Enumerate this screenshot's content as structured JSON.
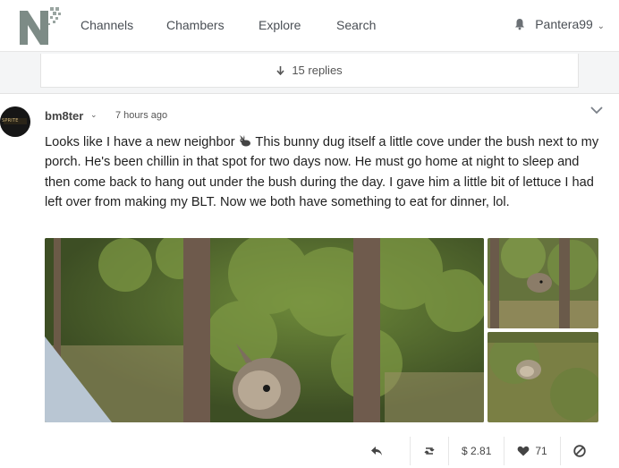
{
  "nav": {
    "links": [
      "Channels",
      "Chambers",
      "Explore",
      "Search"
    ],
    "username": "Pantera99",
    "bell_icon": "bell-icon",
    "brand_color": "#7d8b86"
  },
  "replies": {
    "label": "15 replies",
    "icon": "arrow-down-icon"
  },
  "post": {
    "author": "bm8ter",
    "avatar_text": "SPRITE",
    "timestamp": "7 hours ago",
    "text_before_emoji": "Looks like I have a new neighbor ",
    "text_after_emoji": " This bunny dug itself a little cove under the bush next to my porch. He's been chillin in that spot for two days now. He must go home at night to sleep and then come back to hang out under the bush during the day. I gave him a little bit of lettuce I had left over from making my BLT. Now we both have something to eat for dinner, lol.",
    "emoji_icon": "bunny-emoji-icon",
    "images": [
      "bunny-under-bush-photo",
      "bunny-close-photo",
      "bunny-on-grass-photo"
    ]
  },
  "actions": {
    "reply_icon": "reply-icon",
    "repost_icon": "repost-icon",
    "earnings": "$ 2.81",
    "likes": "71",
    "heart_icon": "heart-icon",
    "block_icon": "block-icon"
  }
}
